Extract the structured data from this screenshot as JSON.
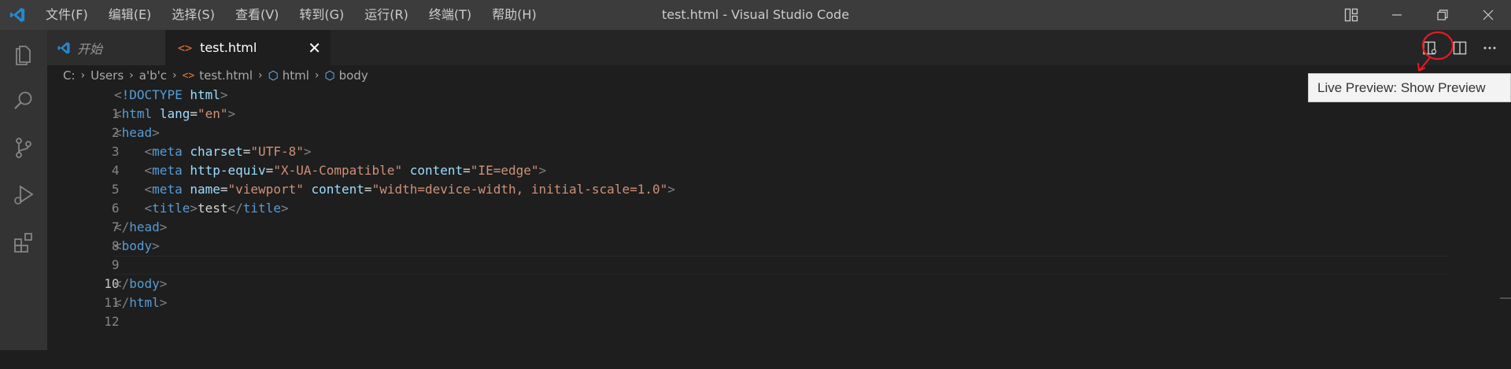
{
  "window": {
    "title": "test.html - Visual Studio Code",
    "menu": [
      "文件(F)",
      "编辑(E)",
      "选择(S)",
      "查看(V)",
      "转到(G)",
      "运行(R)",
      "终端(T)",
      "帮助(H)"
    ]
  },
  "tabs": [
    {
      "label": "开始",
      "icon": "vscode-icon"
    },
    {
      "label": "test.html",
      "icon": "html-file-icon"
    }
  ],
  "breadcrumb": {
    "path": [
      "C:",
      "Users",
      "a'b'c"
    ],
    "file": "test.html",
    "symbols": [
      "html",
      "body"
    ]
  },
  "tooltip": "Live Preview: Show Preview",
  "editor": {
    "line_numbers": [
      "1",
      "2",
      "3",
      "4",
      "5",
      "6",
      "7",
      "8",
      "9",
      "10",
      "11",
      "12"
    ],
    "active_line": 10
  },
  "colors": {
    "accent": "#007acc",
    "annotation": "#e51c23",
    "tag": "#569cd6",
    "attribute": "#9cdcfe",
    "string": "#ce9178"
  }
}
